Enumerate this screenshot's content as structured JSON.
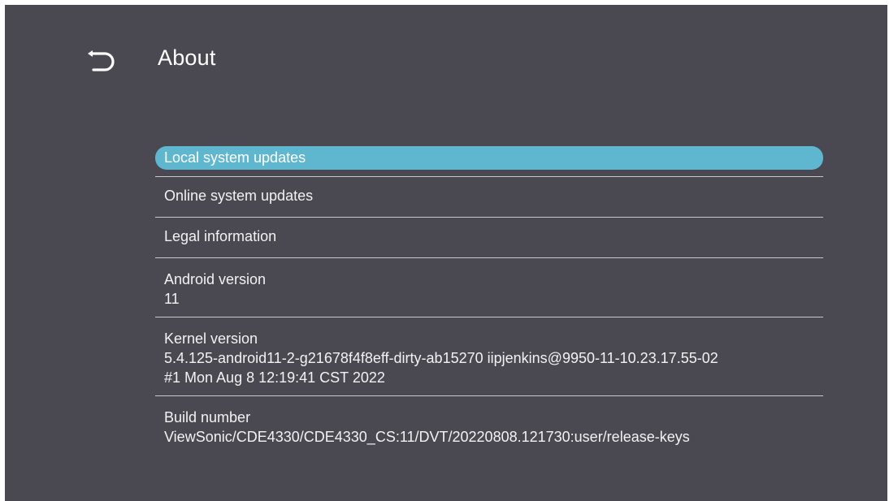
{
  "header": {
    "title": "About",
    "back_icon": "back-arrow-icon"
  },
  "menu": {
    "items": [
      {
        "label": "Local system updates",
        "selected": true
      },
      {
        "label": "Online system updates"
      },
      {
        "label": "Legal information"
      }
    ],
    "details": [
      {
        "label": "Android version",
        "value": "11"
      },
      {
        "label": "Kernel version",
        "value": "5.4.125-android11-2-g21678f4f8eff-dirty-ab15270 iipjenkins@9950-11-10.23.17.55-02\n#1 Mon Aug 8 12:19:41 CST 2022"
      },
      {
        "label": "Build number",
        "value": "ViewSonic/CDE4330/CDE4330_CS:11/DVT/20220808.121730:user/release-keys"
      }
    ]
  },
  "colors": {
    "background": "#4a4952",
    "accent": "#5fb6cf",
    "divider": "#c9c8cd"
  }
}
